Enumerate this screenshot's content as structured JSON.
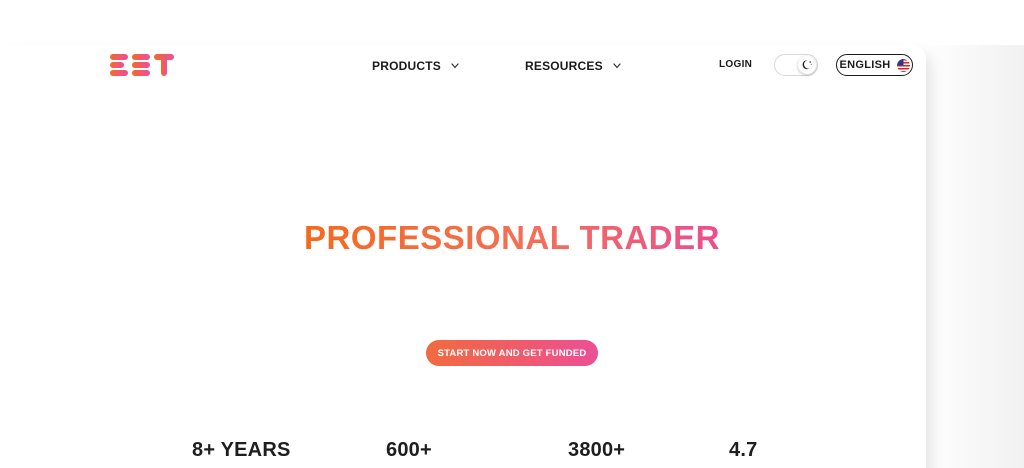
{
  "brand": {
    "logo_text": "E2T",
    "colors": {
      "orange": "#f46a1c",
      "pink": "#ec4f96"
    }
  },
  "nav": {
    "items": [
      {
        "label": "PRODUCTS",
        "icon": "chevron-down-icon"
      },
      {
        "label": "RESOURCES",
        "icon": "chevron-down-icon"
      }
    ]
  },
  "header": {
    "login_label": "LOGIN",
    "theme_toggle_icon": "moon-icon",
    "language_label": "ENGLISH",
    "language_icon": "us-flag-icon"
  },
  "hero": {
    "title": "PROFESSIONAL TRADER",
    "cta_label": "START NOW AND GET FUNDED"
  },
  "stats": [
    {
      "value": "8+ YEARS"
    },
    {
      "value": "600+"
    },
    {
      "value": "3800+"
    },
    {
      "value": "4.7"
    }
  ]
}
